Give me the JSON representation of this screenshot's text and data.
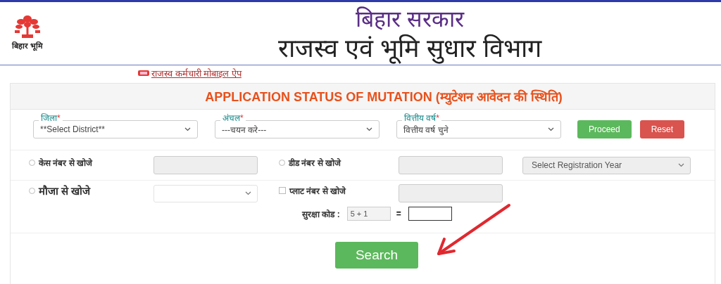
{
  "header": {
    "logo_caption": "बिहार भूमि",
    "title": "बिहार सरकार",
    "subtitle": "राजस्व एवं भूमि सुधार विभाग"
  },
  "app_link": {
    "label": "राजस्व कर्मचारी मोबाइल ऐप"
  },
  "form": {
    "title": "APPLICATION STATUS OF MUTATION (म्युटेशन आवेदन की स्थिति)",
    "selects": [
      {
        "label": "जिला",
        "mark": "*",
        "value": "**Select District**"
      },
      {
        "label": "अंचल",
        "mark": "*",
        "value": "---चयन करे---"
      },
      {
        "label": "वित्तीय वर्ष",
        "mark": "*",
        "value": "वित्तीय वर्ष चुने"
      }
    ],
    "buttons": [
      {
        "label": "Proceed",
        "kind": "success"
      },
      {
        "label": "Reset",
        "kind": "danger"
      }
    ],
    "search_rows": [
      {
        "items": [
          {
            "kind": "radio",
            "label": "केस नंबर से खोजे",
            "selected": false
          },
          {
            "kind": "text"
          },
          {
            "kind": "radio",
            "label": "डीड नंबर से खोजे",
            "selected": false
          },
          {
            "kind": "text"
          },
          {
            "kind": "select",
            "placeholder": "Select Registration Year"
          }
        ]
      },
      {
        "items": [
          {
            "kind": "radio",
            "label": "मौजा से खोजे",
            "selected": false,
            "large": true
          },
          {
            "kind": "select"
          },
          {
            "kind": "checkbox",
            "label": "प्लाट नंबर से खोजे",
            "checked": false
          },
          {
            "kind": "text"
          }
        ]
      }
    ],
    "captcha": {
      "label": "सुरक्षा कोड :",
      "question": "5 + 1",
      "equals": "="
    },
    "submit": "Search"
  }
}
